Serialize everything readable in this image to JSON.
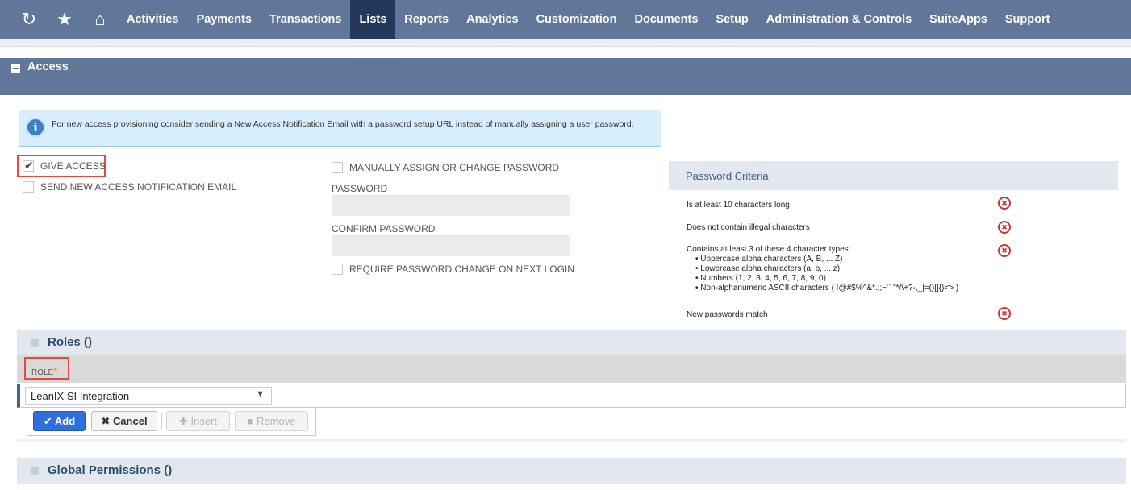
{
  "nav": {
    "icons": [
      "recent-icon",
      "star-icon",
      "home-icon"
    ],
    "items": [
      "Activities",
      "Payments",
      "Transactions",
      "Lists",
      "Reports",
      "Analytics",
      "Customization",
      "Documents",
      "Setup",
      "Administration & Controls",
      "SuiteApps",
      "Support"
    ],
    "active": "Lists"
  },
  "access": {
    "title": "Access",
    "info_text": "For new access provisioning consider sending a New Access Notification Email with a password setup URL instead of manually assigning a user password.",
    "give_access_label": "GIVE ACCESS",
    "give_access_checked": true,
    "send_notification_label": "SEND NEW ACCESS NOTIFICATION EMAIL",
    "send_notification_checked": false,
    "manual_password_label": "MANUALLY ASSIGN OR CHANGE PASSWORD",
    "manual_password_checked": false,
    "password_label": "PASSWORD",
    "password_value": "",
    "confirm_password_label": "CONFIRM PASSWORD",
    "confirm_password_value": "",
    "require_change_label": "REQUIRE PASSWORD CHANGE ON NEXT LOGIN",
    "require_change_checked": false
  },
  "password_criteria": {
    "title": "Password Criteria",
    "items": [
      "Is at least 10 characters long",
      "Does not contain illegal characters",
      "Contains at least 3 of these 4 character types:",
      "New passwords match"
    ],
    "subitems": [
      "• Uppercase alpha characters (A, B, ... Z)",
      "• Lowercase alpha characters (a, b, ... z)",
      "• Numbers (1, 2, 3, 4, 5, 6, 7, 8, 9, 0)",
      "• Non-alphanumeric ASCII characters ( !@#$%^&*.;;~'` \"*/\\+?-,_|=()[]{}<> )"
    ],
    "fail_icon": "x-circle-icon"
  },
  "roles": {
    "title": "Roles ()",
    "role_label": "ROLE",
    "required_mark": "*",
    "selected_role": "LeanIX SI Integration",
    "add_label": "Add",
    "cancel_label": "Cancel",
    "insert_label": "Insert",
    "remove_label": "Remove"
  },
  "global_permissions": {
    "title": "Global Permissions ()"
  }
}
